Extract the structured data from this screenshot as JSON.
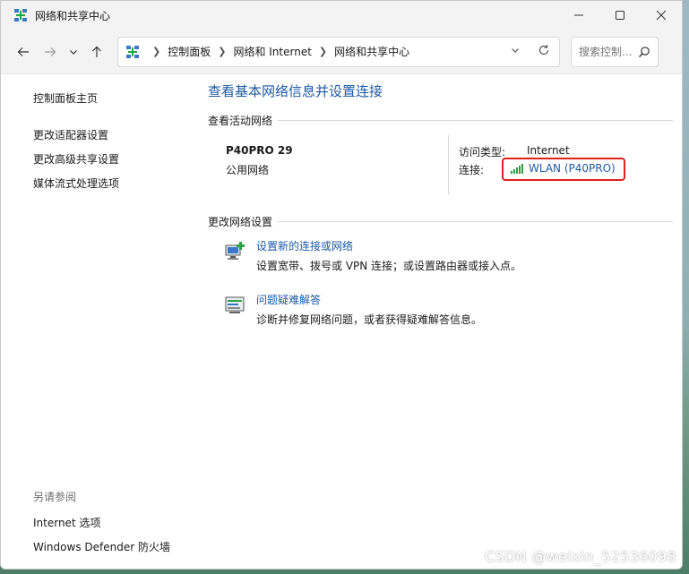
{
  "window": {
    "title": "网络和共享中心",
    "icon": "network-center-icon"
  },
  "titlebar_controls": {
    "minimize": "minimize-icon",
    "maximize": "maximize-icon",
    "close": "close-icon"
  },
  "address": {
    "crumbs": [
      "控制面板",
      "网络和 Internet",
      "网络和共享中心"
    ]
  },
  "search": {
    "placeholder": "搜索控制..."
  },
  "sidebar": {
    "home": "控制面板主页",
    "items": [
      "更改适配器设置",
      "更改高级共享设置",
      "媒体流式处理选项"
    ]
  },
  "see_also": {
    "header": "另请参阅",
    "items": [
      "Internet 选项",
      "Windows Defender 防火墙"
    ]
  },
  "main": {
    "title": "查看基本网络信息并设置连接",
    "active_section": "查看活动网络",
    "network": {
      "name": "P40PRO 29",
      "type": "公用网络",
      "access_label": "访问类型:",
      "access_value": "Internet",
      "connection_label": "连接:",
      "connection_value": "WLAN (P40PRO)"
    },
    "change_section": "更改网络设置",
    "tasks": [
      {
        "link": "设置新的连接或网络",
        "desc": "设置宽带、拨号或 VPN 连接；或设置路由器或接入点。",
        "icon": "new-connection-icon"
      },
      {
        "link": "问题疑难解答",
        "desc": "诊断并修复网络问题，或者获得疑难解答信息。",
        "icon": "troubleshoot-icon"
      }
    ]
  },
  "watermark": "CSDN @weixin_52536098",
  "colors": {
    "link": "#1c5aa6",
    "highlight_border": "#e0201c",
    "signal": "#2ea043"
  }
}
